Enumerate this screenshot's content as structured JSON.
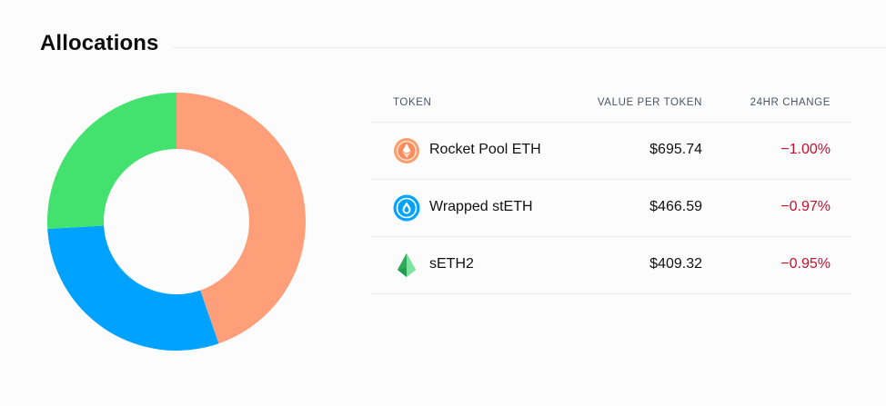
{
  "header": {
    "title": "Allocations"
  },
  "table": {
    "columns": [
      "TOKEN",
      "VALUE PER TOKEN",
      "24HR CHANGE"
    ],
    "rows": [
      {
        "name": "Rocket Pool ETH",
        "value": "$695.74",
        "change": "−1.00%",
        "icon": "rocket-pool-eth-icon"
      },
      {
        "name": "Wrapped stETH",
        "value": "$466.59",
        "change": "−0.97%",
        "icon": "wrapped-steth-icon"
      },
      {
        "name": "sETH2",
        "value": "$409.32",
        "change": "−0.95%",
        "icon": "seth2-icon"
      }
    ]
  },
  "colors": {
    "negative": "#c8102e",
    "slice_orange": "#ff9f7a",
    "slice_blue": "#00a2ff",
    "slice_green": "#43e26f"
  },
  "chart_data": {
    "type": "pie",
    "donut": true,
    "start_angle_deg": 0,
    "direction": "clockwise",
    "series": [
      {
        "value": 44.7,
        "color": "#ff9f7a"
      },
      {
        "value": 29.4,
        "color": "#00a2ff"
      },
      {
        "value": 25.9,
        "color": "#43e26f"
      }
    ]
  }
}
